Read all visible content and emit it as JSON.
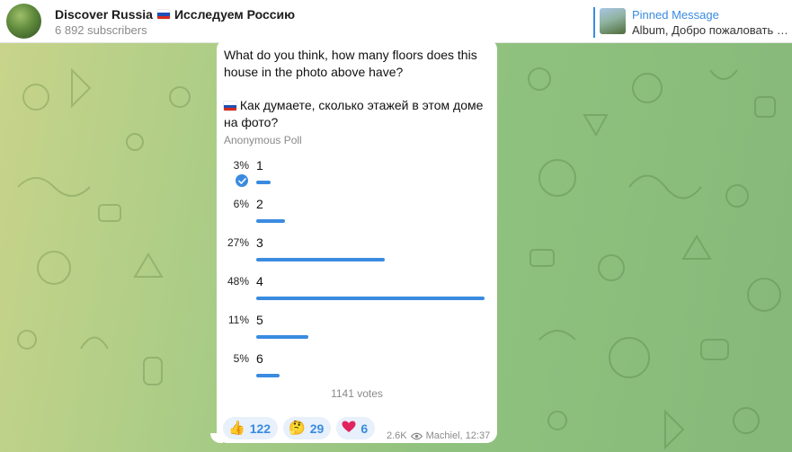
{
  "header": {
    "channel_title": "Discover Russia",
    "channel_title_ru": "Исследуем Россию",
    "subscribers": "6 892 subscribers",
    "pinned": {
      "title": "Pinned Message",
      "text": "Album, Добро пожаловать в ..."
    }
  },
  "message": {
    "question_en": "What do you think, how many floors does this house in the photo above have?",
    "question_ru": "Как думаете, сколько этажей в этом доме на фото?",
    "poll_type": "Anonymous Poll",
    "options": [
      {
        "percent": "3%",
        "label": "1",
        "fraction": 0.03,
        "chosen": true
      },
      {
        "percent": "6%",
        "label": "2",
        "fraction": 0.06,
        "chosen": false
      },
      {
        "percent": "27%",
        "label": "3",
        "fraction": 0.27,
        "chosen": false
      },
      {
        "percent": "48%",
        "label": "4",
        "fraction": 0.48,
        "chosen": false
      },
      {
        "percent": "11%",
        "label": "5",
        "fraction": 0.11,
        "chosen": false
      },
      {
        "percent": "5%",
        "label": "6",
        "fraction": 0.05,
        "chosen": false
      }
    ],
    "votes": "1141 votes",
    "reactions": [
      {
        "emoji": "👍",
        "count": "122",
        "icon": "thumbs-up-icon"
      },
      {
        "emoji": "🤔",
        "count": "29",
        "icon": "thinking-face-icon"
      },
      {
        "emoji": "❤",
        "count": "6",
        "icon": "heart-icon"
      }
    ],
    "views": "2.6K",
    "signature": "Machiel, 12:37"
  },
  "colors": {
    "accent": "#3a8be0",
    "bubble": "#ffffff",
    "reaction_bg": "#e7f0fb"
  }
}
